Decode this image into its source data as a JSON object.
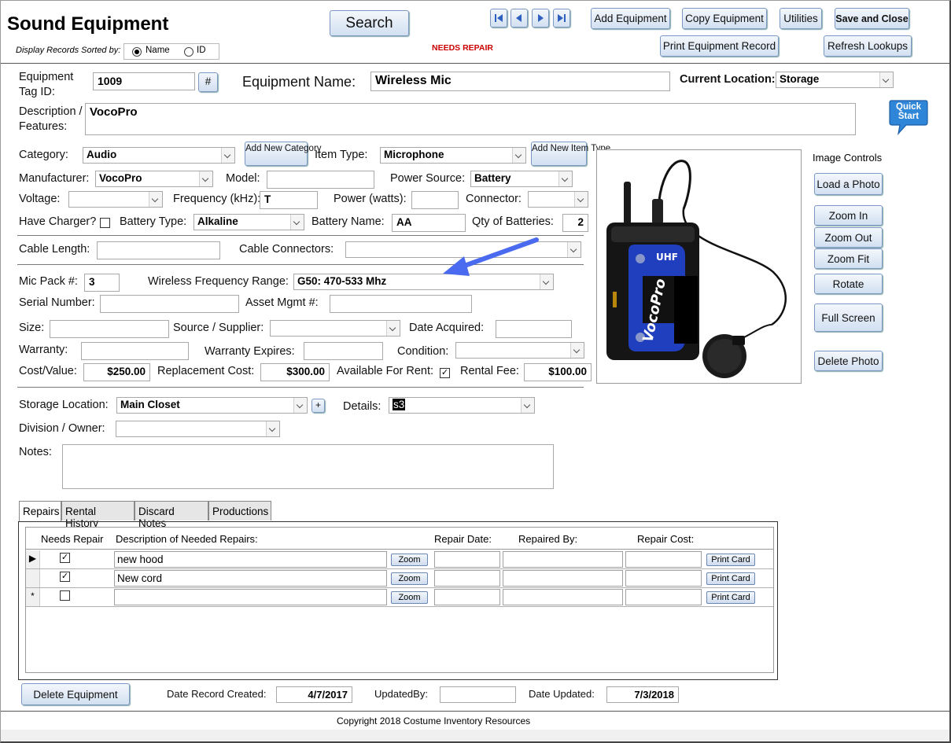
{
  "header": {
    "title": "Sound Equipment",
    "sort_label": "Display Records Sorted by:",
    "sort_name": "Name",
    "sort_id": "ID",
    "search_label": "Search",
    "status_text": "NEEDS REPAIR",
    "add_equipment": "Add Equipment",
    "copy_equipment": "Copy Equipment",
    "utilities": "Utilities",
    "save_close": "Save and Close",
    "print_record": "Print Equipment Record",
    "refresh_lookups": "Refresh Lookups"
  },
  "colors": {
    "status": "#cc0000",
    "accent_button": "#d2e0f1",
    "quick_start": "#2f86d8"
  },
  "record": {
    "tag_label": "Equipment Tag ID:",
    "tag_value": "1009",
    "hash_label": "#",
    "name_label": "Equipment Name:",
    "name_value": "Wireless Mic",
    "location_label": "Current Location:",
    "location_value": "Storage",
    "desc_label": "Description / Features:",
    "desc_value": "VocoPro",
    "quick_start": "Quick Start"
  },
  "details": {
    "category_label": "Category:",
    "category_value": "Audio",
    "add_category": "Add New Category",
    "item_type_label": "Item Type:",
    "item_type_value": "Microphone",
    "add_item_type": "Add New Item Type",
    "manufacturer_label": "Manufacturer:",
    "manufacturer_value": "VocoPro",
    "model_label": "Model:",
    "model_value": "",
    "power_source_label": "Power Source:",
    "power_source_value": "Battery",
    "voltage_label": "Voltage:",
    "voltage_value": "",
    "frequency_label": "Frequency (kHz):",
    "frequency_value": "T",
    "power_watts_label": "Power (watts):",
    "power_watts_value": "",
    "connector_label": "Connector:",
    "connector_value": "",
    "charger_label": "Have Charger?",
    "battery_type_label": "Battery Type:",
    "battery_type_value": "Alkaline",
    "battery_name_label": "Battery Name:",
    "battery_name_value": "AA",
    "qty_batteries_label": "Qty of Batteries:",
    "qty_batteries_value": "2",
    "cable_length_label": "Cable Length:",
    "cable_length_value": "",
    "cable_connectors_label": "Cable Connectors:",
    "cable_connectors_value": "",
    "mic_pack_label": "Mic Pack #:",
    "mic_pack_value": "3",
    "wireless_label": "Wireless Frequency Range:",
    "wireless_value": "G50: 470-533 Mhz",
    "serial_label": "Serial Number:",
    "serial_value": "",
    "asset_label": "Asset Mgmt #:",
    "asset_value": "",
    "size_label": "Size:",
    "size_value": "",
    "source_label": "Source / Supplier:",
    "source_value": "",
    "date_acquired_label": "Date Acquired:",
    "date_acquired_value": "",
    "warranty_label": "Warranty:",
    "warranty_value": "",
    "warranty_expires_label": "Warranty Expires:",
    "warranty_expires_value": "",
    "condition_label": "Condition:",
    "condition_value": "",
    "cost_label": "Cost/Value:",
    "cost_value": "$250.00",
    "replacement_label": "Replacement Cost:",
    "replacement_value": "$300.00",
    "available_label": "Available For Rent:",
    "rental_fee_label": "Rental Fee:",
    "rental_fee_value": "$100.00",
    "storage_label": "Storage Location:",
    "storage_value": "Main Closet",
    "plus": "+",
    "details_label": "Details:",
    "details_value": "s3",
    "division_label": "Division / Owner:",
    "division_value": "",
    "notes_label": "Notes:",
    "notes_value": ""
  },
  "image_controls": {
    "title": "Image Controls",
    "load": "Load a Photo",
    "zoom_in": "Zoom In",
    "zoom_out": "Zoom Out",
    "zoom_fit": "Zoom Fit",
    "rotate": "Rotate",
    "full_screen": "Full Screen",
    "delete": "Delete Photo",
    "photo_brand": "VocoPro",
    "photo_badge": "UHF"
  },
  "tabs": [
    "Repairs",
    "Rental History",
    "Discard Notes",
    "Productions"
  ],
  "repairs": {
    "headers": {
      "needs": "Needs Repair",
      "desc": "Description of Needed Repairs:",
      "date": "Repair Date:",
      "by": "Repaired By:",
      "cost": "Repair Cost:"
    },
    "zoom": "Zoom",
    "print_card": "Print Card",
    "rows": [
      {
        "selector": "▶",
        "needs": true,
        "desc": "new hood",
        "date": "",
        "by": "",
        "cost": ""
      },
      {
        "selector": "",
        "needs": true,
        "desc": "New cord",
        "date": "",
        "by": "",
        "cost": ""
      },
      {
        "selector": "*",
        "needs": false,
        "desc": "",
        "date": "",
        "by": "",
        "cost": ""
      }
    ]
  },
  "footer": {
    "delete_equipment": "Delete Equipment",
    "created_label": "Date Record Created:",
    "created_value": "4/7/2017",
    "updated_by_label": "UpdatedBy:",
    "updated_by_value": "",
    "updated_label": "Date Updated:",
    "updated_value": "7/3/2018",
    "copyright": "Copyright 2018   Costume Inventory Resources"
  }
}
